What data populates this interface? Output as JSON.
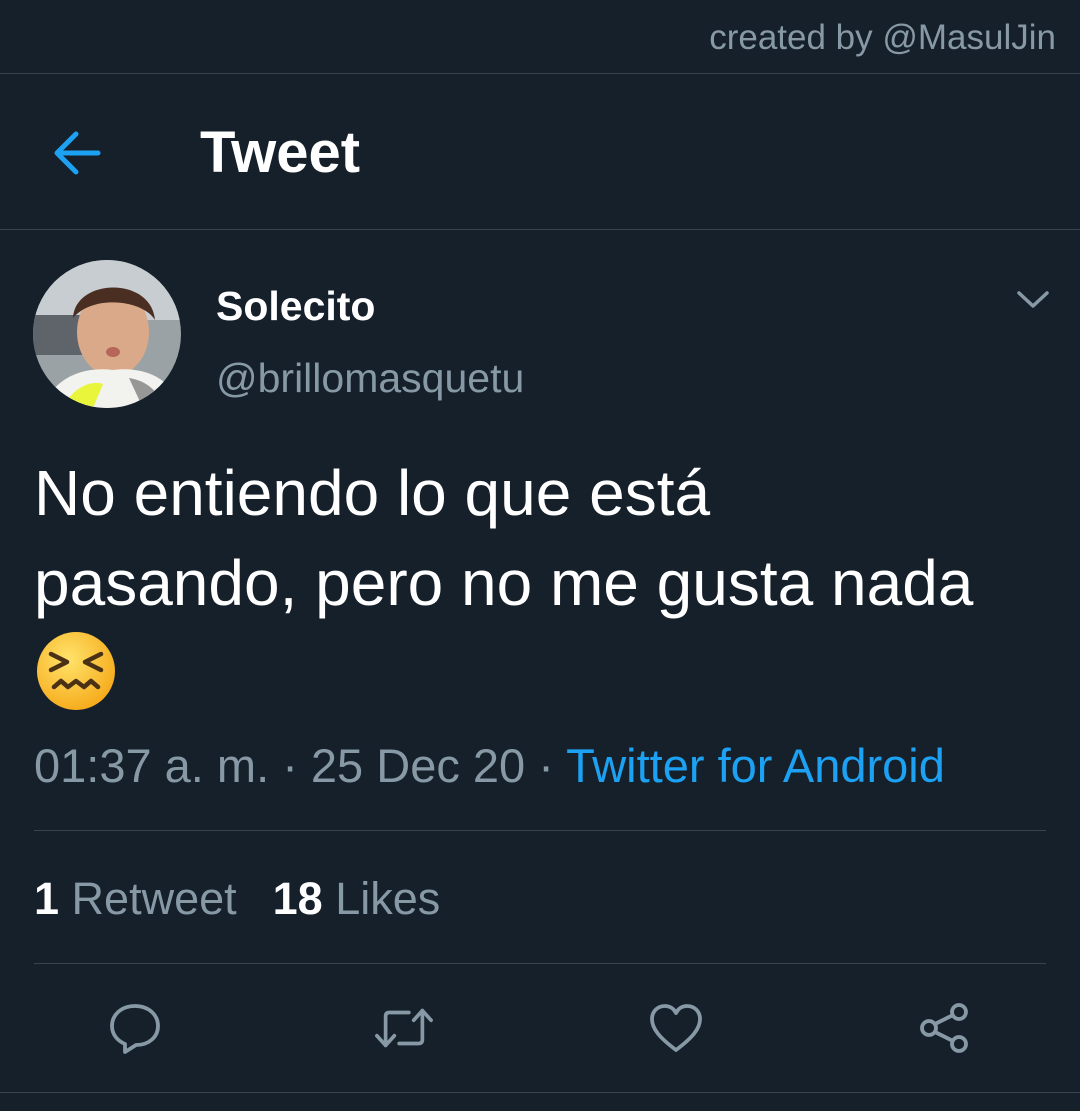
{
  "credit": "created by @MasulJin",
  "header": {
    "title": "Tweet",
    "back_icon": "arrow-left-icon"
  },
  "tweet": {
    "display_name": "Solecito",
    "handle": "@brillomasquetu",
    "text_lines": [
      "No entiendo lo que está",
      "pasando, pero no me gusta nada"
    ],
    "emoji": "confounded-face-emoji",
    "time": "01:37 a. m.",
    "separator": " · ",
    "date": "25 Dec 20",
    "source": "Twitter for Android",
    "retweets_count": "1",
    "retweets_label": "Retweet",
    "likes_count": "18",
    "likes_label": "Likes"
  },
  "actions": [
    "reply-icon",
    "retweet-icon",
    "like-icon",
    "share-icon"
  ],
  "colors": {
    "background": "#15202b",
    "divider": "#38444d",
    "secondary_text": "#8899a6",
    "accent": "#1da1f2"
  }
}
